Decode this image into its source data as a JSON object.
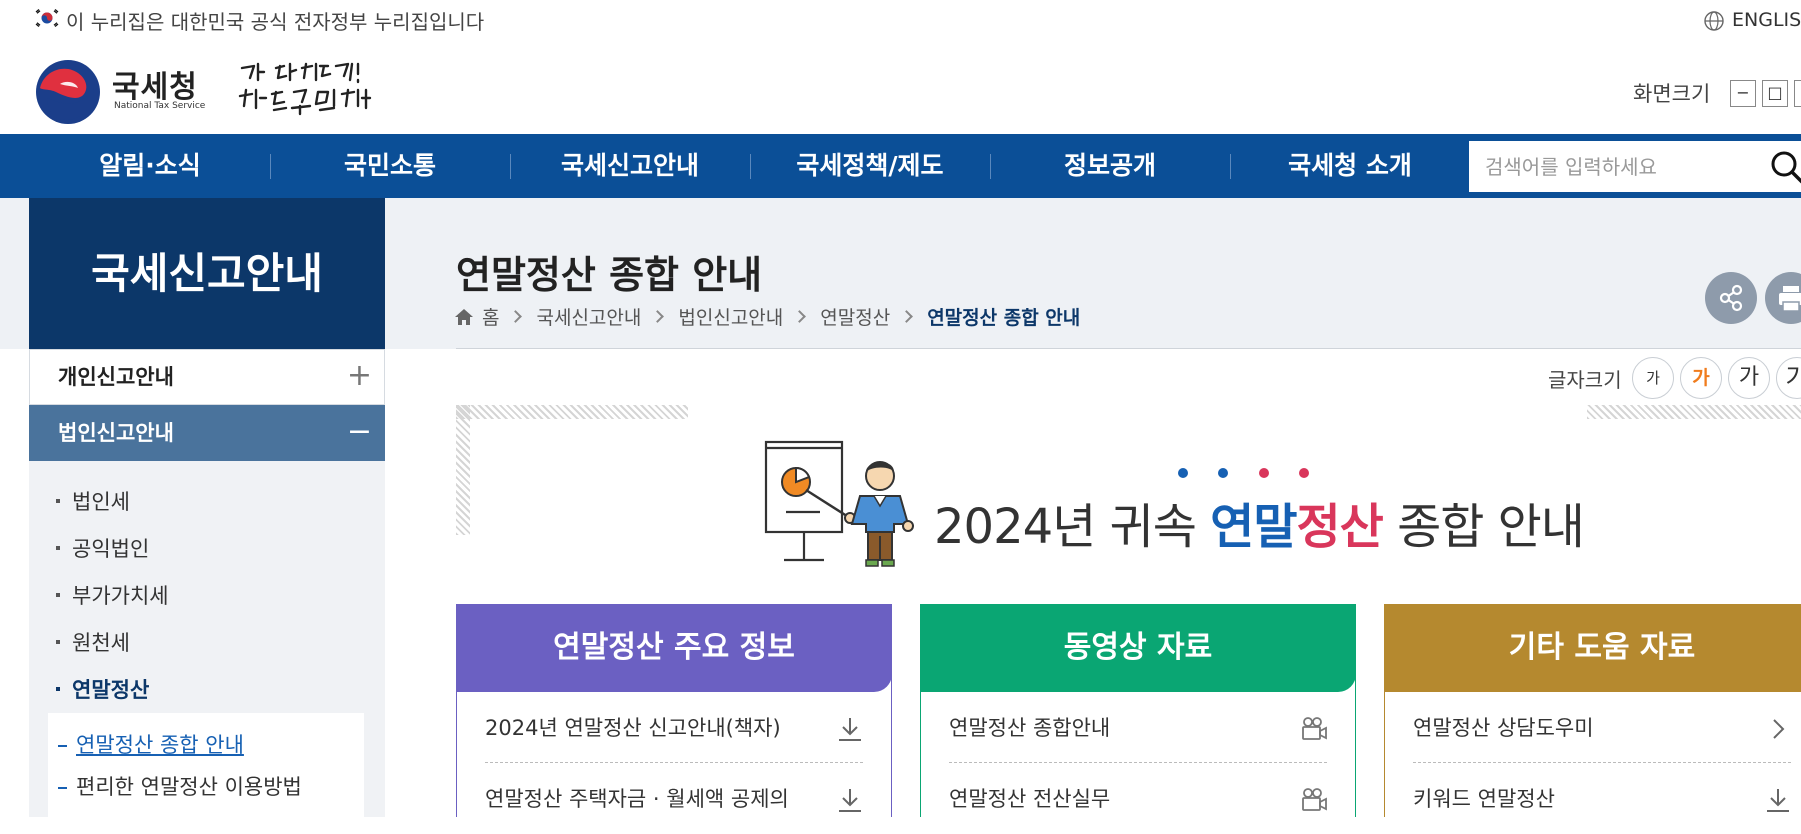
{
  "gov_banner": {
    "text": "이 누리집은 대한민국 공식 전자정부 누리집입니다",
    "language_link": "ENGLISH"
  },
  "header": {
    "logo_text": "국세청",
    "logo_subtext": "National Tax Service",
    "slogan": "다시 대한민국! 새로운 국민의 나라",
    "screen_size_label": "화면크기",
    "zoom_buttons": [
      "−",
      "□",
      "+"
    ]
  },
  "nav": {
    "items": [
      "알림·소식",
      "국민소통",
      "국세신고안내",
      "국세정책/제도",
      "정보공개",
      "국세청 소개"
    ],
    "search_placeholder": "검색어를 입력하세요"
  },
  "sidebar": {
    "title": "국세신고안내",
    "sections": [
      {
        "label": "개인신고안내",
        "toggle": "+"
      },
      {
        "label": "법인신고안내",
        "toggle": "−"
      }
    ],
    "sub_items": [
      "법인세",
      "공익법인",
      "부가가치세",
      "원천세",
      "연말정산"
    ],
    "deep_items": [
      "연말정산 종합 안내",
      "편리한 연말정산 이용방법"
    ]
  },
  "page": {
    "title": "연말정산 종합 안내",
    "breadcrumb": [
      "홈",
      "국세신고안내",
      "법인신고안내",
      "연말정산",
      "연말정산 종합 안내"
    ],
    "font_size_label": "글자크기",
    "font_size_buttons": [
      "가",
      "가",
      "가",
      "가"
    ]
  },
  "hero": {
    "prefix": "2024년 귀속 ",
    "highlight_blue": "연말",
    "highlight_red": "정산",
    "suffix": " 종합 안내"
  },
  "cards": [
    {
      "title": "연말정산 주요 정보",
      "color": "#6b60c2",
      "rows": [
        {
          "text": "2024년 연말정산 신고안내(책자)",
          "icon": "download-icon"
        },
        {
          "text": "연말정산 주택자금 · 월세액 공제의",
          "icon": "download-icon"
        }
      ]
    },
    {
      "title": "동영상 자료",
      "color": "#0aa673",
      "rows": [
        {
          "text": "연말정산 종합안내",
          "icon": "video-camera-icon"
        },
        {
          "text": "연말정산 전산실무",
          "icon": "video-camera-icon"
        }
      ]
    },
    {
      "title": "기타 도움 자료",
      "color": "#b5892f",
      "rows": [
        {
          "text": "연말정산 상담도우미",
          "icon": "chevron-right-icon"
        },
        {
          "text": "키워드 연말정산",
          "icon": "download-icon"
        }
      ]
    }
  ],
  "colors": {
    "nav_bg": "#0b4f97",
    "sidebar_title_bg": "#0c3769",
    "sidebar_active_bg": "#4a739c",
    "accent_blue": "#1660b3",
    "accent_red": "#d9365b",
    "font_size_active": "#f07c1d"
  }
}
